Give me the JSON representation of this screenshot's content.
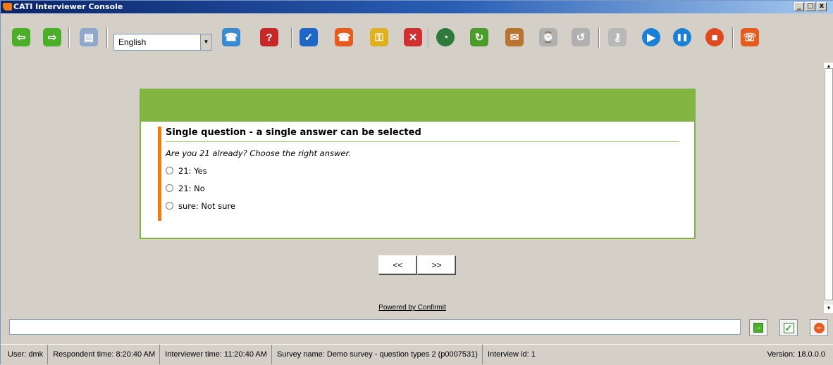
{
  "window": {
    "title": "CATI Interviewer Console",
    "minimize": "_",
    "restore": "□",
    "close": "x"
  },
  "toolbar": {
    "language": "English",
    "buttons": [
      {
        "name": "back-icon",
        "color": "#4caf2a",
        "glyph": "⇦"
      },
      {
        "name": "forward-icon",
        "color": "#4caf2a",
        "glyph": "⇨"
      },
      {
        "name": "document-icon",
        "color": "#8fa7c8",
        "glyph": "▤"
      },
      {
        "name": "call-transfer-icon",
        "color": "#3a8ad0",
        "glyph": "☎"
      },
      {
        "name": "help-skip-icon",
        "color": "#c62828",
        "glyph": "?"
      },
      {
        "name": "spellcheck-icon",
        "color": "#1e66c8",
        "glyph": "✓"
      },
      {
        "name": "hangup-icon",
        "color": "#e65c1f",
        "glyph": "☎"
      },
      {
        "name": "key-icon",
        "color": "#e0b020",
        "glyph": "⚿"
      },
      {
        "name": "cancel-icon",
        "color": "#d03030",
        "glyph": "✕"
      },
      {
        "name": "timer-icon",
        "color": "#2f7a3a",
        "glyph": "◔"
      },
      {
        "name": "schedule-icon",
        "color": "#4b9c2a",
        "glyph": "↻"
      },
      {
        "name": "mailbox-icon",
        "color": "#b87430",
        "glyph": "✉"
      },
      {
        "name": "appointment-icon",
        "color": "#b0b0b0",
        "glyph": "⌚"
      },
      {
        "name": "refresh-icon",
        "color": "#b0b0b0",
        "glyph": "↺"
      },
      {
        "name": "key-disabled-icon",
        "color": "#b8b8b8",
        "glyph": "⚷"
      },
      {
        "name": "play-icon",
        "color": "#1a7fd6",
        "glyph": "▶"
      },
      {
        "name": "pause-icon",
        "color": "#1a7fd6",
        "glyph": "❚❚"
      },
      {
        "name": "stop-icon",
        "color": "#e0491f",
        "glyph": "■"
      },
      {
        "name": "phone-settings-icon",
        "color": "#e65c1f",
        "glyph": "☏"
      }
    ]
  },
  "survey": {
    "question_title": "Single question - a single answer can be selected",
    "question_text": "Are you 21 already? Choose the right answer.",
    "options": [
      "21: Yes",
      "21: No",
      "sure: Not sure"
    ],
    "prev_label": "<<",
    "next_label": ">>",
    "powered_by": "Powered by Confirmit"
  },
  "command_bar": {
    "input_value": ""
  },
  "status": {
    "user": "User:  dmk",
    "respondent_time": "Respondent time:  8:20:40 AM",
    "interviewer_time": "Interviewer time:  11:20:40 AM",
    "survey_name": "Survey name:  Demo survey - question types 2 (p0007531)",
    "interview_id": "Interview id:  1",
    "version": "Version:  18.0.0.0"
  },
  "colors": {
    "accent_green": "#82b541",
    "accent_orange": "#f07a14",
    "title_blue": "#0a246a"
  }
}
